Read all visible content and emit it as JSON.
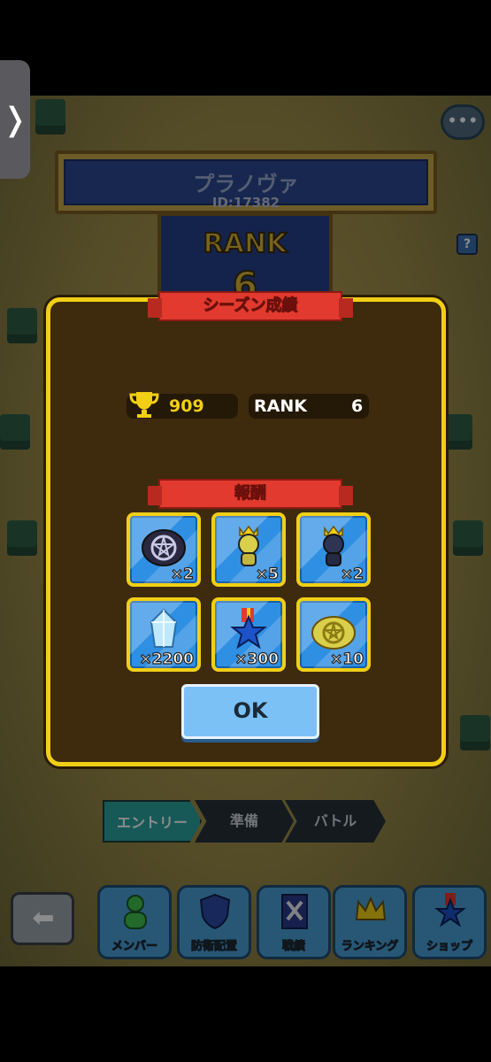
{
  "player": {
    "name": "プラノヴァ",
    "id": "ID:17382"
  },
  "rank_banner": {
    "label": "RANK",
    "value": "6"
  },
  "dialog": {
    "title": "シーズン成績",
    "score": "909",
    "rank_label": "RANK",
    "rank_value": "6",
    "rewards_title": "報酬",
    "rewards": [
      {
        "icon": "dark-seal-icon",
        "count": "×2"
      },
      {
        "icon": "gold-crowned-figure-icon",
        "count": "×5"
      },
      {
        "icon": "dark-crowned-figure-icon",
        "count": "×2"
      },
      {
        "icon": "crystal-icon",
        "count": "×2200"
      },
      {
        "icon": "star-medal-icon",
        "count": "×300"
      },
      {
        "icon": "gold-seal-icon",
        "count": "×10"
      }
    ],
    "ok_label": "OK"
  },
  "steps": [
    "エントリー",
    "準備",
    "バトル"
  ],
  "nav": [
    "メンバー",
    "防衛配置",
    "戦績",
    "ランキング",
    "ショップ"
  ],
  "colors": {
    "frame": "#f2cf16",
    "dialog_bg": "#3e2a0d",
    "ribbon": "#e23a2e",
    "item_bg": "#2f8fe3",
    "ok_button": "#7cc1f6"
  }
}
